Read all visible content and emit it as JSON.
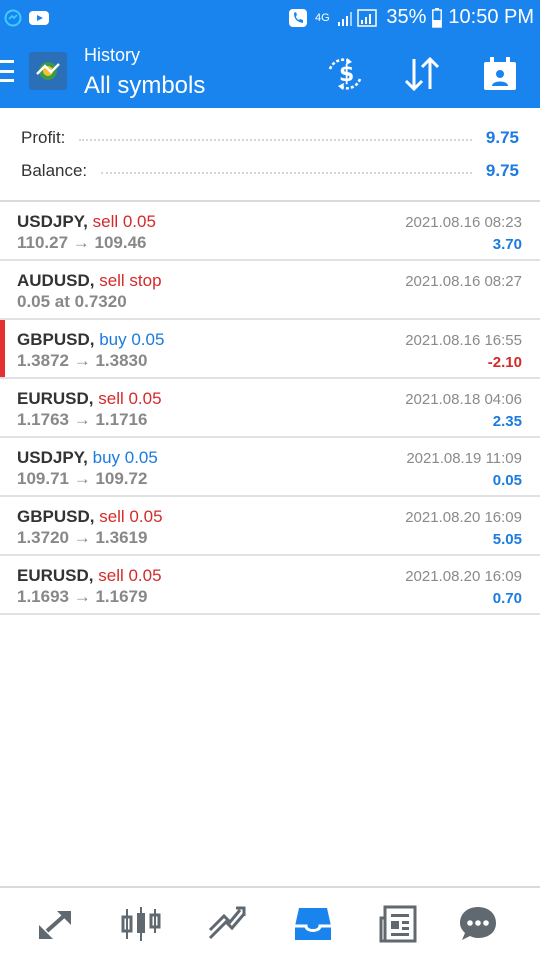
{
  "status_bar": {
    "network": "4G",
    "battery": "35%",
    "time": "10:50 PM"
  },
  "header": {
    "subtitle": "History",
    "title": "All symbols",
    "icons": [
      "menu-icon",
      "app-logo",
      "currency-exchange-icon",
      "sort-icon",
      "calendar-icon"
    ]
  },
  "summary": {
    "profit_label": "Profit:",
    "profit_value": "9.75",
    "balance_label": "Balance:",
    "balance_value": "9.75"
  },
  "trades": [
    {
      "symbol": "USDJPY,",
      "type": "sell 0.05",
      "side": "sell",
      "prices": "110.27 → 109.46",
      "date": "2021.08.16 08:23",
      "profit": "3.70",
      "negative": false,
      "highlight": false
    },
    {
      "symbol": "AUDUSD,",
      "type": "sell stop",
      "side": "sell",
      "prices": "0.05 at 0.7320",
      "date": "2021.08.16 08:27",
      "profit": "",
      "negative": false,
      "highlight": false
    },
    {
      "symbol": "GBPUSD,",
      "type": "buy 0.05",
      "side": "buy",
      "prices": "1.3872 → 1.3830",
      "date": "2021.08.16 16:55",
      "profit": "-2.10",
      "negative": true,
      "highlight": true
    },
    {
      "symbol": "EURUSD,",
      "type": "sell 0.05",
      "side": "sell",
      "prices": "1.1763 → 1.1716",
      "date": "2021.08.18 04:06",
      "profit": "2.35",
      "negative": false,
      "highlight": false
    },
    {
      "symbol": "USDJPY,",
      "type": "buy 0.05",
      "side": "buy",
      "prices": "109.71 → 109.72",
      "date": "2021.08.19 11:09",
      "profit": "0.05",
      "negative": false,
      "highlight": false
    },
    {
      "symbol": "GBPUSD,",
      "type": "sell 0.05",
      "side": "sell",
      "prices": "1.3720 → 1.3619",
      "date": "2021.08.20 16:09",
      "profit": "5.05",
      "negative": false,
      "highlight": false
    },
    {
      "symbol": "EURUSD,",
      "type": "sell 0.05",
      "side": "sell",
      "prices": "1.1693 → 1.1679",
      "date": "2021.08.20 16:09",
      "profit": "0.70",
      "negative": false,
      "highlight": false
    }
  ],
  "bottom_nav": [
    {
      "name": "quotes-icon",
      "active": false
    },
    {
      "name": "chart-icon",
      "active": false
    },
    {
      "name": "trade-icon",
      "active": false
    },
    {
      "name": "history-icon",
      "active": true
    },
    {
      "name": "news-icon",
      "active": false
    },
    {
      "name": "chat-icon",
      "active": false
    }
  ],
  "colors": {
    "primary": "#1a84ee",
    "sell": "#d42a2a",
    "buy": "#1a7be0",
    "marker": "#e53030"
  }
}
